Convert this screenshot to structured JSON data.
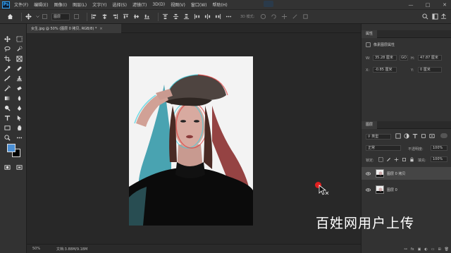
{
  "menu": {
    "logo": "Ps",
    "items": [
      "文件(F)",
      "编辑(E)",
      "图像(I)",
      "图层(L)",
      "文字(Y)",
      "选择(S)",
      "滤镜(T)",
      "3D(D)",
      "视图(V)",
      "窗口(W)",
      "帮助(H)"
    ]
  },
  "options_bar": {
    "layer_select": "图层",
    "mode_3d": "3D 模式:"
  },
  "document_tab": {
    "title": "女生.jpg @ 50% (图层 0 拷贝, RGB/8) *",
    "close": "×"
  },
  "status_bar": {
    "zoom": "50%",
    "doc_size": "文档:3.88M/9.18M"
  },
  "properties_panel": {
    "tab": "属性",
    "subtitle": "像素图层属性",
    "w_label": "W:",
    "w_value": "35.28 厘米",
    "link_label": "GO",
    "h_label": "H:",
    "h_value": "47.87 厘米",
    "x_label": "X:",
    "x_value": "-0.85 厘米",
    "y_label": "Y:",
    "y_value": "0 厘米"
  },
  "layers_panel": {
    "tab": "图层",
    "filter_kind": "类型",
    "blend_mode": "正常",
    "opacity_label": "不透明度:",
    "opacity_value": "100%",
    "lock_label": "锁定:",
    "fill_label": "填充:",
    "fill_value": "100%",
    "layers": [
      {
        "name": "图层 0 拷贝",
        "selected": true
      },
      {
        "name": "图层 0",
        "selected": false
      }
    ],
    "bottom_icons": [
      "fx",
      "mask",
      "adjust",
      "group",
      "new",
      "trash"
    ]
  },
  "watermark": "百姓网用户上传",
  "colors": {
    "foreground": "#4b8fd4",
    "background": "#000000",
    "cursor": "#e02020"
  }
}
